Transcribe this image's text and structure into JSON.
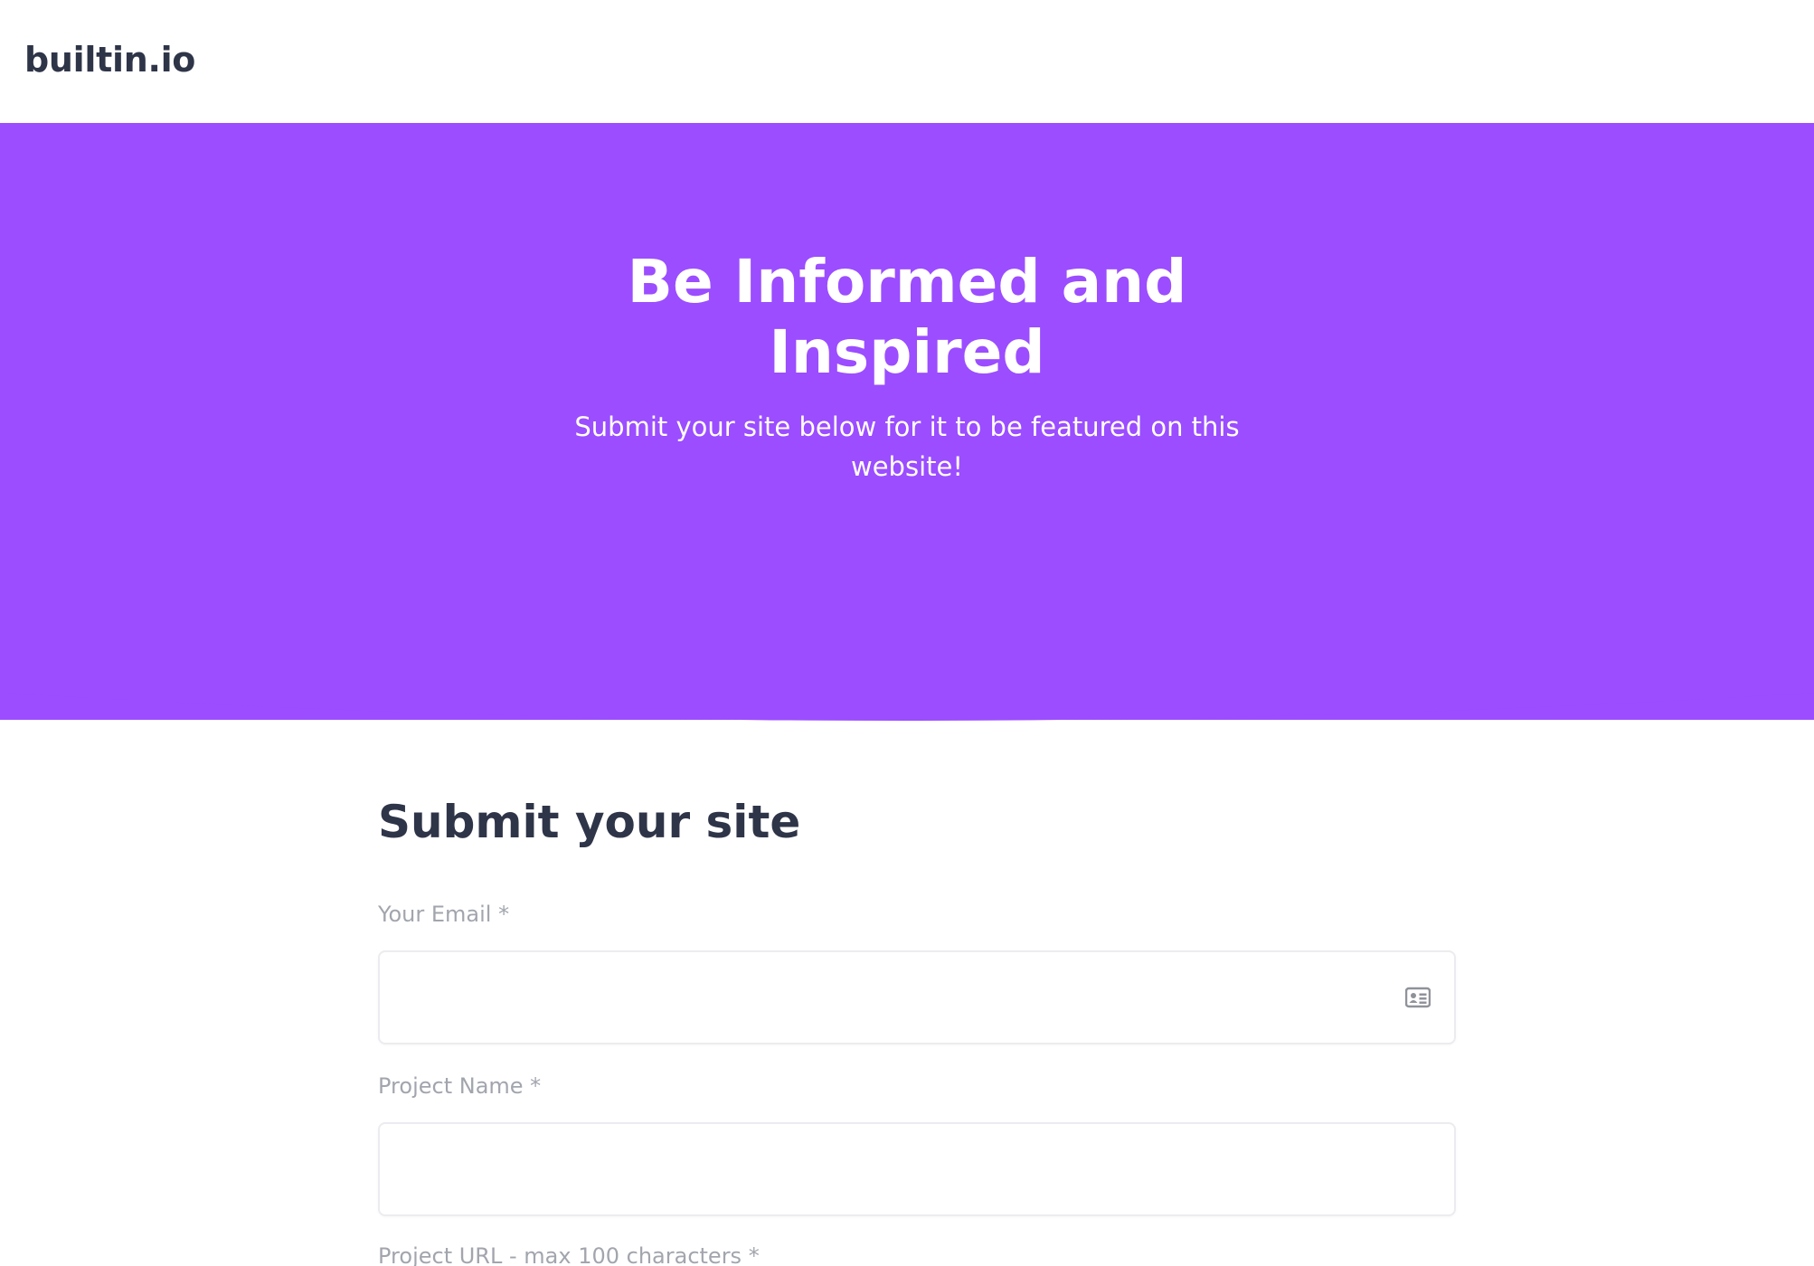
{
  "header": {
    "logo_text": "builtin.io"
  },
  "hero": {
    "title_line1": "Be Informed and",
    "title_line2": "Inspired",
    "subtitle_line1": "Submit your site below for it to be featured on this",
    "subtitle_line2": "website!",
    "background_color": "#9b4dff"
  },
  "form": {
    "title": "Submit your site",
    "fields": [
      {
        "label": "Your Email *",
        "value": "",
        "icon": "contact-card-icon"
      },
      {
        "label": "Project Name *",
        "value": ""
      },
      {
        "label": "Project URL - max 100 characters *"
      }
    ]
  }
}
